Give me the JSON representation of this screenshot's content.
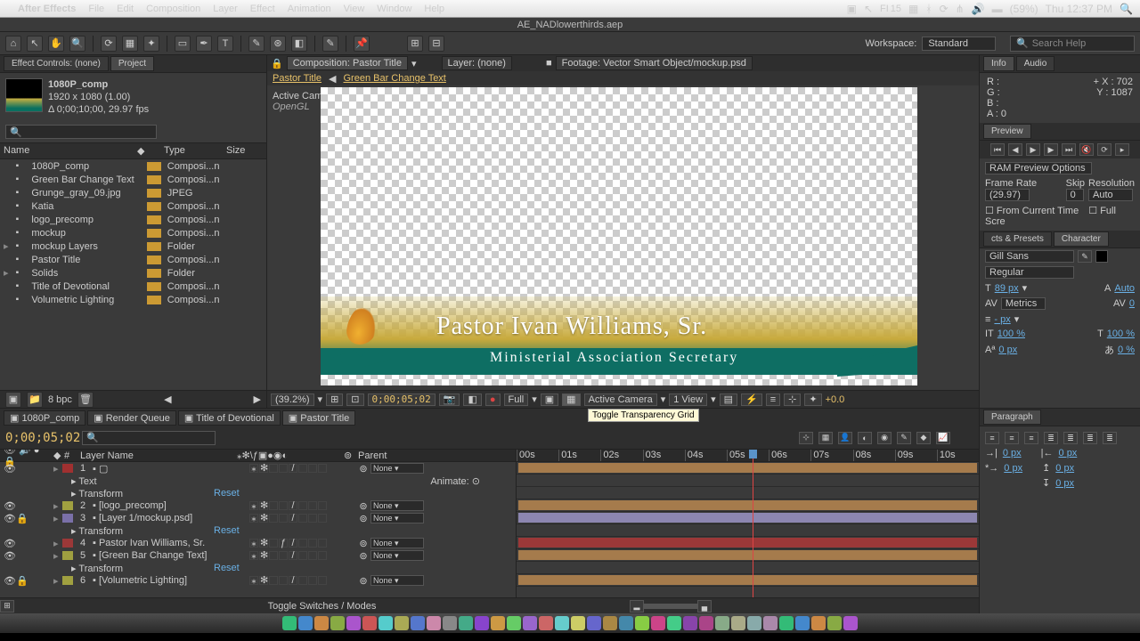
{
  "menubar": {
    "app": "After Effects",
    "items": [
      "File",
      "Edit",
      "Composition",
      "Layer",
      "Effect",
      "Animation",
      "View",
      "Window",
      "Help"
    ],
    "status": {
      "fi": "FI",
      "fi_val": "15",
      "battery": "(59%)",
      "clock": "Thu 12:37 PM"
    }
  },
  "window_title": "AE_NADlowerthirds.aep",
  "toolbar": {
    "workspace_label": "Workspace:",
    "workspace": "Standard",
    "search_placeholder": "Search Help"
  },
  "project": {
    "tabs": {
      "effects": "Effect Controls: (none)",
      "project": "Project"
    },
    "selected": {
      "name": "1080P_comp",
      "dims": "1920 x 1080 (1.00)",
      "dur": "Δ 0;00;10;00, 29.97 fps"
    },
    "columns": [
      "Name",
      "",
      "Type",
      "Size"
    ],
    "items": [
      {
        "tw": "",
        "name": "1080P_comp",
        "type": "Composi...n"
      },
      {
        "tw": "",
        "name": "Green Bar Change Text",
        "type": "Composi...n"
      },
      {
        "tw": "",
        "name": "Grunge_gray_09.jpg",
        "type": "JPEG"
      },
      {
        "tw": "",
        "name": "Katia",
        "type": "Composi...n"
      },
      {
        "tw": "",
        "name": "logo_precomp",
        "type": "Composi...n"
      },
      {
        "tw": "",
        "name": "mockup",
        "type": "Composi...n"
      },
      {
        "tw": "▸",
        "name": "mockup Layers",
        "type": "Folder"
      },
      {
        "tw": "",
        "name": "Pastor Title",
        "type": "Composi...n"
      },
      {
        "tw": "▸",
        "name": "Solids",
        "type": "Folder"
      },
      {
        "tw": "",
        "name": "Title of Devotional",
        "type": "Composi...n"
      },
      {
        "tw": "",
        "name": "Volumetric Lighting",
        "type": "Composi...n"
      }
    ],
    "footer_bpc": "8 bpc"
  },
  "comp": {
    "tabs": {
      "comp": "Composition: Pastor Title",
      "layer": "Layer: (none)",
      "footage": "Footage: Vector Smart Object/mockup.psd"
    },
    "flow": [
      "Pastor Title",
      "Green Bar Change Text"
    ],
    "overlay1": "Active Camera",
    "overlay2": "OpenGL",
    "canvas": {
      "name": "Pastor Ivan Williams, Sr.",
      "subtitle": "Ministerial Association Secretary"
    },
    "footer": {
      "zoom": "(39.2%)",
      "time": "0;00;05;02",
      "res": "Full",
      "cam": "Active Camera",
      "view": "1 View",
      "exp": "+0.0"
    },
    "tooltip": "Toggle Transparency Grid"
  },
  "info": {
    "tabs": [
      "Info",
      "Audio"
    ],
    "vals": {
      "R": "R :",
      "G": "G :",
      "B": "B :",
      "A": "A : 0",
      "X": "X : 702",
      "Y": "Y : 1087"
    }
  },
  "preview": {
    "title": "Preview",
    "options_label": "RAM Preview Options",
    "labels": {
      "fr": "Frame Rate",
      "skip": "Skip",
      "res": "Resolution"
    },
    "vals": {
      "fr": "(29.97)",
      "skip": "0",
      "res": "Auto"
    },
    "checks": [
      "From Current Time",
      "Full Scre"
    ]
  },
  "side_tabs": [
    "cts & Presets",
    "Character"
  ],
  "character": {
    "font": "Gill Sans",
    "style": "Regular",
    "size": "89 px",
    "leading": "Auto",
    "kerning": "Metrics",
    "tracking": "0",
    "hshift": "- px",
    "vscale": "100 %",
    "hscale": "100 %",
    "baseline": "0 px",
    "tsume": "0 %"
  },
  "paragraph": {
    "title": "Paragraph",
    "left": "0 px",
    "right": "0 px",
    "first": "0 px",
    "before": "0 px",
    "after": "0 px"
  },
  "timeline": {
    "tabs": [
      "1080P_comp",
      "Render Queue",
      "Title of Devotional",
      "Pastor Title"
    ],
    "active_tab": 3,
    "timecode": "0;00;05;02",
    "col_layername": "Layer Name",
    "col_parent": "Parent",
    "layers": [
      {
        "num": "1",
        "color": "#a03030",
        "name": "▢",
        "parent": "None",
        "bar": "#a57b4c"
      },
      {
        "num": "2",
        "color": "#a0a040",
        "name": "[logo_precomp]",
        "parent": "None",
        "bar": "#a57b4c"
      },
      {
        "num": "3",
        "color": "#7a70a8",
        "name": "[Layer 1/mockup.psd]",
        "parent": "None",
        "bar": "#8c86b0"
      },
      {
        "num": "4",
        "color": "#9c3838",
        "name": "Pastor Ivan Williams, Sr.",
        "parent": "None",
        "bar": "#9c3838"
      },
      {
        "num": "5",
        "color": "#a0a040",
        "name": "[Green Bar Change Text]",
        "parent": "None",
        "bar": "#a57b4c"
      },
      {
        "num": "6",
        "color": "#a0a040",
        "name": "[Volumetric Lighting]",
        "parent": "None",
        "bar": "#a57b4c"
      }
    ],
    "sub_text": "Text",
    "sub_transform": "Transform",
    "sub_reset": "Reset",
    "animate": "Animate:",
    "ruler": [
      "00s",
      "01s",
      "02s",
      "03s",
      "04s",
      "05s",
      "06s",
      "07s",
      "08s",
      "09s",
      "10s"
    ],
    "footer": "Toggle Switches / Modes"
  }
}
